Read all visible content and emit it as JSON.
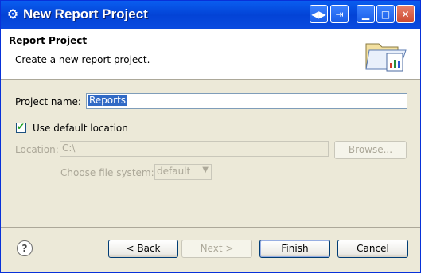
{
  "window": {
    "title": "New Report Project"
  },
  "header": {
    "title": "Report Project",
    "description": "Create a new report project."
  },
  "form": {
    "project_name_label": "Project name:",
    "project_name_value": "Reports",
    "use_default_label": "Use default location",
    "use_default_checked": true,
    "location_label": "Location:",
    "location_value": "C:\\",
    "browse_label": "Browse...",
    "filesystem_label": "Choose file system:",
    "filesystem_value": "default"
  },
  "buttons": {
    "back": "< Back",
    "next": "Next >",
    "finish": "Finish",
    "cancel": "Cancel"
  },
  "colors": {
    "titlebar": "#0a5ef0",
    "dialog": "#ece9d8",
    "selection": "#316ac5"
  }
}
